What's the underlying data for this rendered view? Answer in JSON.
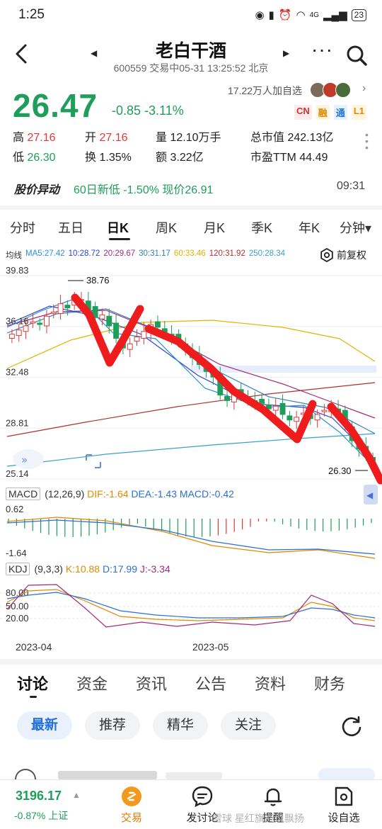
{
  "status": {
    "time": "1:25",
    "battery": "23",
    "net": "4G"
  },
  "header": {
    "title": "老白干酒",
    "subtitle": "600559 交易中05-31 13:25:52 北京"
  },
  "quote": {
    "price": "26.47",
    "change": "-0.85 -3.11%",
    "followers": "17.22万人加自选",
    "badges": [
      "CN",
      "融",
      "通",
      "L1"
    ],
    "stats": {
      "high_label": "高",
      "high": "27.16",
      "open_label": "开",
      "open": "27.16",
      "vol_label": "量",
      "vol": "12.10万手",
      "mcap_label": "总市值",
      "mcap": "242.13亿",
      "low_label": "低",
      "low": "26.30",
      "turn_label": "换",
      "turn": "1.35%",
      "amt_label": "额",
      "amt": "3.22亿",
      "pe_label": "市盈TTM",
      "pe": "44.49"
    }
  },
  "alert": {
    "label": "股价异动",
    "text": "60日新低 -1.50% 现价26.91",
    "time": "09:31"
  },
  "periods": [
    "分时",
    "五日",
    "日K",
    "周K",
    "月K",
    "季K",
    "年K",
    "分钟▾"
  ],
  "ma_legend": {
    "label": "均线",
    "items": [
      {
        "text": "MA5:27.42",
        "color": "#2b8fd6"
      },
      {
        "text": "10:28.72",
        "color": "#2b3fd6"
      },
      {
        "text": "20:29.67",
        "color": "#a12a7a"
      },
      {
        "text": "30:31.17",
        "color": "#2f7fb8"
      },
      {
        "text": "60:33.46",
        "color": "#e0b400"
      },
      {
        "text": "120:31.92",
        "color": "#b03030"
      },
      {
        "text": "250:28.34",
        "color": "#3aa0c8"
      }
    ]
  },
  "adjust_label": "前复权",
  "macd": {
    "label": "MACD",
    "params": "(12,26,9)",
    "dif": "DIF:-1.64",
    "dea": "DEA:-1.43",
    "macd": "MACD:-0.42"
  },
  "kdj": {
    "label": "KDJ",
    "params": "(9,3,3)",
    "k": "K:10.88",
    "d": "D:17.99",
    "j": "J:-3.34"
  },
  "chart_data": {
    "type": "candlestick",
    "y_ticks": [
      "39.83",
      "36.16",
      "32.48",
      "28.81",
      "25.14"
    ],
    "ylim": [
      25.14,
      39.83
    ],
    "max_label": "38.76",
    "min_label": "26.30",
    "x_ticks": [
      "2023-04",
      "2023-05"
    ],
    "macd_ticks": [
      "0.62",
      "-1.64"
    ],
    "kdj_ticks": [
      "80.00",
      "50.00",
      "20.00"
    ],
    "closes": [
      35.6,
      35.9,
      36.2,
      36.5,
      36.3,
      36.9,
      37.2,
      37.8,
      37.5,
      38.2,
      38.1,
      37.4,
      36.8,
      37.0,
      36.2,
      35.3,
      34.6,
      34.9,
      35.4,
      35.8,
      36.3,
      36.1,
      35.7,
      35.4,
      35.0,
      34.5,
      33.9,
      33.4,
      32.9,
      32.5,
      31.2,
      30.8,
      31.4,
      31.1,
      30.9,
      30.7,
      30.6,
      30.2,
      30.4,
      29.8,
      29.4,
      29.6,
      29.9,
      29.5,
      29.8,
      30.1,
      30.3,
      29.9,
      29.0,
      27.9,
      27.3,
      26.8,
      26.47
    ]
  },
  "tabs": [
    "讨论",
    "资金",
    "资讯",
    "公告",
    "资料",
    "财务"
  ],
  "subtabs": [
    "最新",
    "推荐",
    "精华",
    "关注"
  ],
  "bottom": {
    "index_value": "3196.17",
    "index_sub": "-0.87% 上证",
    "nav": [
      "交易",
      "发讨论",
      "提醒",
      "设自选"
    ],
    "watermark": "雪球 星红旗迎风飘扬"
  }
}
